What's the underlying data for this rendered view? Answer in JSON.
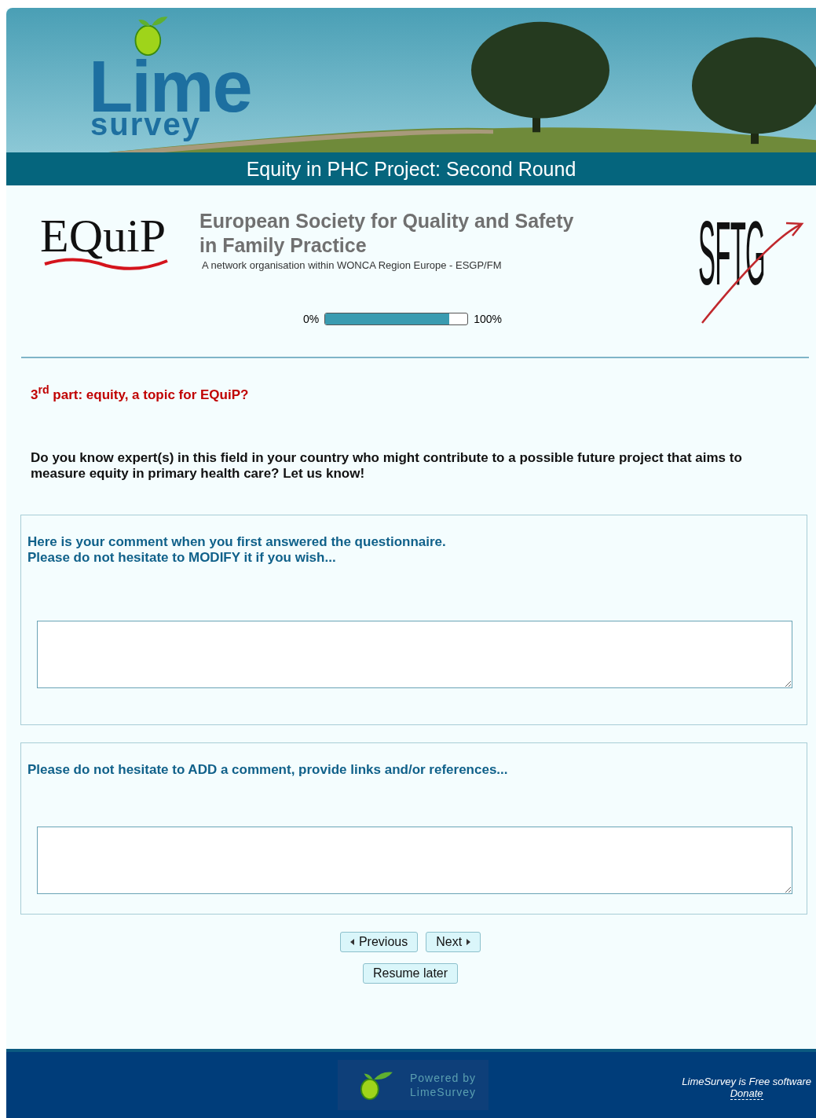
{
  "header": {
    "logo_word_1": "Lime",
    "logo_word_2": "survey",
    "title": "Equity in PHC Project: Second Round"
  },
  "branding": {
    "left_logo": "EQuiP",
    "society_name_1": "European Society for Quality and Safety",
    "society_name_2": "in Family Practice",
    "society_tagline": "A network organisation within WONCA Region Europe - ESGP/FM",
    "right_logo": "SFTG"
  },
  "progress": {
    "start_label": "0%",
    "end_label": "100%",
    "level": 0.87
  },
  "section_title": "3$^{rd}$ part: equity, a topic for EQuiP?",
  "intro": "Do you know expert(s) in this field in your country who might contribute to a possible future project that aims to measure equity in primary health care? Let us know!",
  "questions": [
    {
      "text": "Here is your comment when you first answered the questionnaire.\nPlease do not hesitate to MODIFY it if you wish..."
    },
    {
      "text": "Please do not hesitate to ADD a comment, provide links and/or references..."
    }
  ],
  "buttons": {
    "previous": "Previous",
    "next": "Next",
    "resume": "Resume later"
  },
  "footer": {
    "powered_1": "Powered by",
    "powered_2": "LimeSurvey",
    "free_note": "LimeSurvey is Free software",
    "donate": "Donate"
  }
}
